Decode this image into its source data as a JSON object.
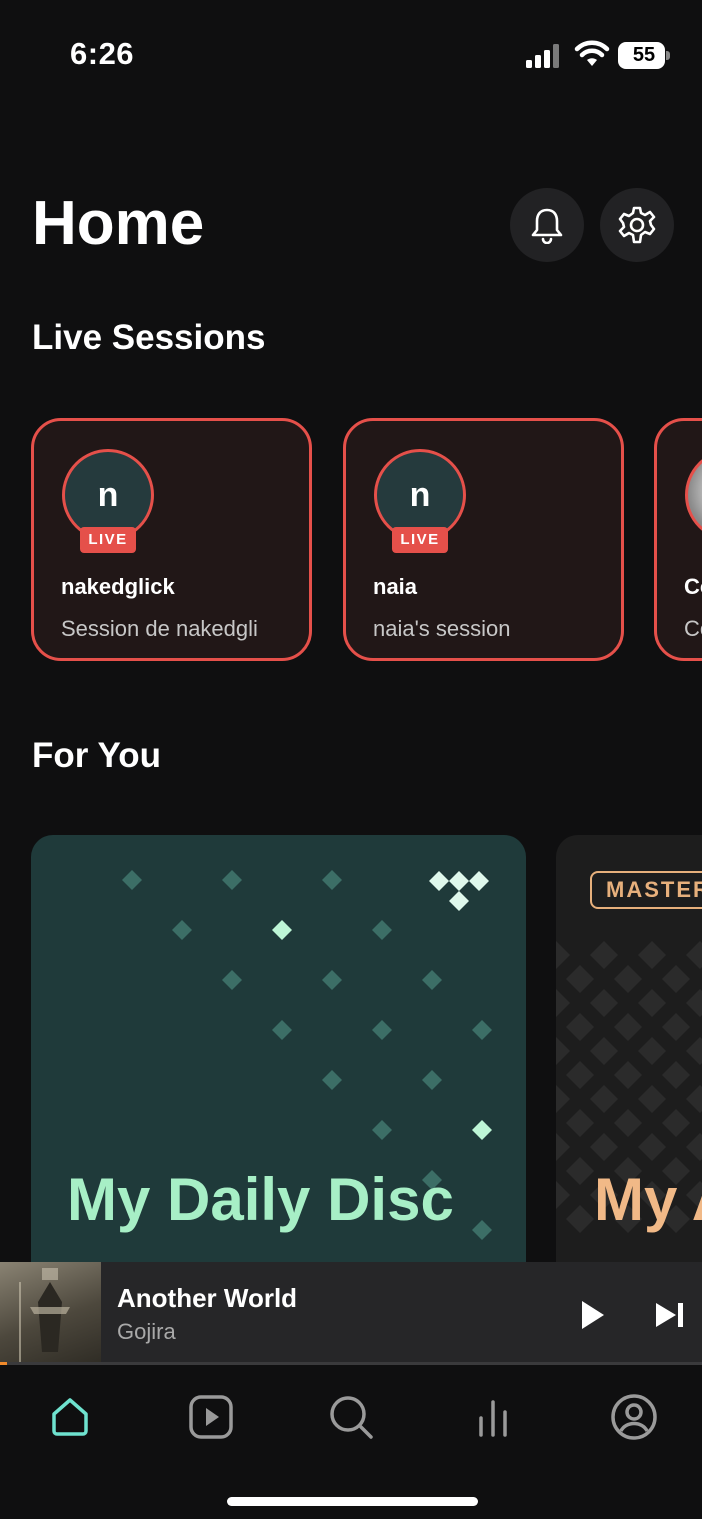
{
  "status_bar": {
    "time": "6:26",
    "battery_level": "55"
  },
  "header": {
    "title": "Home"
  },
  "live_sessions": {
    "title": "Live Sessions",
    "cards": [
      {
        "initial": "n",
        "badge": "LIVE",
        "name": "nakedglick",
        "subtitle": "Session de nakedgli"
      },
      {
        "initial": "n",
        "badge": "LIVE",
        "name": "naia",
        "subtitle": "naia's session"
      },
      {
        "initial": "",
        "badge": "",
        "name": "Co",
        "subtitle": "Co"
      }
    ]
  },
  "for_you": {
    "title": "For You",
    "cards": [
      {
        "title": "My Daily Disc",
        "color": "#a7efc6"
      },
      {
        "badge": "MASTER",
        "title": "My Ar",
        "color": "#f1b987"
      }
    ]
  },
  "now_playing": {
    "title": "Another World",
    "artist": "Gojira",
    "progress": 0.01
  },
  "tabs": [
    {
      "name": "Home",
      "icon": "home-icon",
      "active": true
    },
    {
      "name": "Videos",
      "icon": "play-square-icon",
      "active": false
    },
    {
      "name": "Search",
      "icon": "search-icon",
      "active": false
    },
    {
      "name": "Explore",
      "icon": "bars-icon",
      "active": false
    },
    {
      "name": "My Collection",
      "icon": "profile-icon",
      "active": false
    }
  ],
  "colors": {
    "accent": "#6fe2cf",
    "live": "#e5504a",
    "background": "#0f0f10"
  }
}
